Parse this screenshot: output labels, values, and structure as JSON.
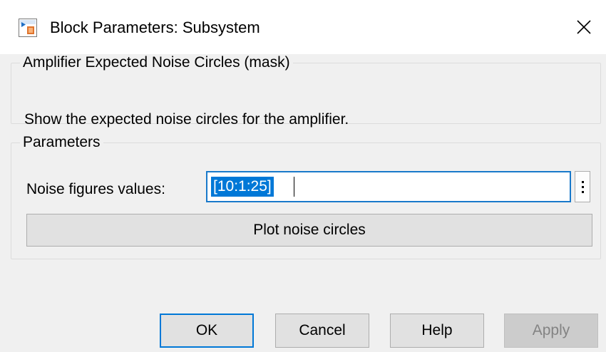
{
  "window": {
    "title": "Block Parameters: Subsystem",
    "icon": "simulink-block-icon",
    "close_icon": "close-icon"
  },
  "mask_group": {
    "legend": "Amplifier Expected Noise Circles (mask)",
    "description": "Show the expected noise circles for the amplifier."
  },
  "parameters_group": {
    "legend": "Parameters",
    "noise_field": {
      "label": "Noise figures values:",
      "value": "[10:1:25]",
      "more_icon": "vertical-ellipsis-icon"
    },
    "plot_button_label": "Plot noise circles"
  },
  "buttons": {
    "ok": "OK",
    "cancel": "Cancel",
    "help": "Help",
    "apply": "Apply"
  },
  "colors": {
    "accent": "#0078d7",
    "selection_bg": "#0078d7",
    "disabled_text": "#838383"
  }
}
